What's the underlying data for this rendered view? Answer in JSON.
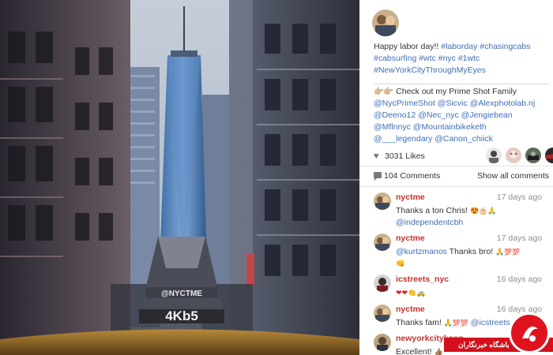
{
  "post": {
    "caption_text": "Happy labor day!!",
    "hashtags": [
      "#laborday",
      "#chasingcabs",
      "#cabsurfing",
      "#wtc",
      "#nyc",
      "#1wtc",
      "#NewYorkCityThroughMyEyes"
    ],
    "family_intro": "Check out my Prime Shot Family",
    "family_mentions": [
      "@NycPrimeShot",
      "@Sicvic",
      "@Alexphotolab.nj",
      "@Deeno12",
      "@Nec_nyc",
      "@Jengiebean",
      "@Mflnnyc",
      "@Mountainbikeketh",
      "@___legendary",
      "@Canon_chiick"
    ],
    "likes_label": "3031 Likes",
    "comments_label": "104 Comments",
    "show_all_label": "Show all comments"
  },
  "photo": {
    "plate_handle": "@NYCTME",
    "plate_number": "4Kb5"
  },
  "comments": [
    {
      "user": "nyctme",
      "time": "17 days ago",
      "text": "Thanks a ton Chris!",
      "mention": "@independentcbh"
    },
    {
      "user": "nyctme",
      "time": "17 days ago",
      "mention": "@kurtzmanos",
      "text": "Thanks bro!"
    },
    {
      "user": "icstreets_nyc",
      "time": "16 days ago",
      "text": ""
    },
    {
      "user": "nyctme",
      "time": "16 days ago",
      "text": "Thanks fam!",
      "mention": "@icstreets"
    },
    {
      "user": "newyorkcitykopp",
      "time": "",
      "text": "Excellent!"
    }
  ],
  "watermark": {
    "label": "باشگاه خبرنگاران"
  },
  "colors": {
    "accent_link": "#3f6fb5",
    "username": "#c4302b",
    "watermark_red": "#d3101b"
  },
  "icons": {
    "likes": "heart-icon",
    "comments": "speech-bubble-icon",
    "hands": "pointing-hands-emoji"
  }
}
